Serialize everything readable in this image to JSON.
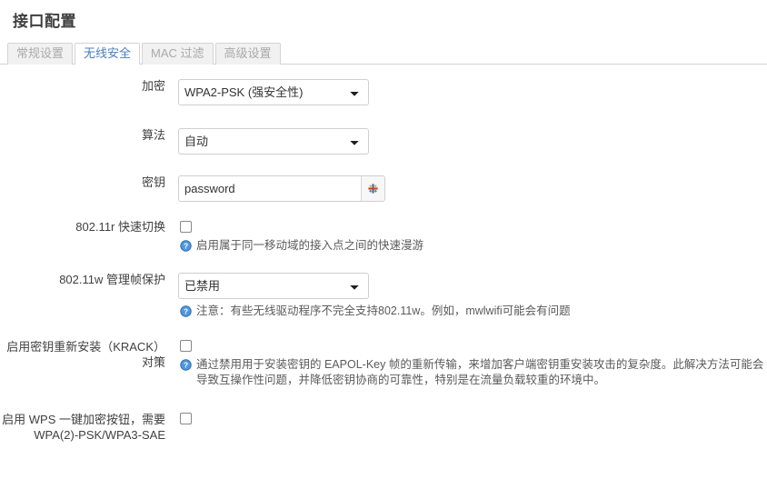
{
  "page": {
    "title": "接口配置"
  },
  "tabs": [
    {
      "label": "常规设置",
      "active": false
    },
    {
      "label": "无线安全",
      "active": true
    },
    {
      "label": "MAC 过滤",
      "active": false
    },
    {
      "label": "高级设置",
      "active": false
    }
  ],
  "form": {
    "encryption": {
      "label": "加密",
      "value": "WPA2-PSK (强安全性)",
      "options": [
        "WPA2-PSK (强安全性)"
      ]
    },
    "cipher": {
      "label": "算法",
      "value": "自动",
      "options": [
        "自动"
      ]
    },
    "key": {
      "label": "密钥",
      "value": "password",
      "placeholder": "",
      "reveal_icon": "asterisk-icon"
    },
    "fast_transition": {
      "label": "802.11r 快速切换",
      "checked": false,
      "hint_icon": "help-circle-icon",
      "hint": "启用属于同一移动域的接入点之间的快速漫游"
    },
    "mfp": {
      "label": "802.11w 管理帧保护",
      "value": "已禁用",
      "options": [
        "已禁用"
      ],
      "hint_icon": "help-circle-icon",
      "hint": "注意：有些无线驱动程序不完全支持802.11w。例如，mwlwifi可能会有问题"
    },
    "krack": {
      "label_line1": "启用密钥重新安装（KRACK）",
      "label_line2": "对策",
      "checked": false,
      "hint_icon": "help-circle-icon",
      "hint": "通过禁用用于安装密钥的 EAPOL-Key 帧的重新传输，来增加客户端密钥重安装攻击的复杂度。此解决方法可能会导致互操作性问题，并降低密钥协商的可靠性，特别是在流量负载较重的环境中。"
    },
    "wps": {
      "label_line1": "启用 WPS 一键加密按钮，需要",
      "label_line2": "WPA(2)-PSK/WPA3-SAE",
      "checked": false
    }
  },
  "colors": {
    "accent": "#4a7ebb",
    "text": "#404040",
    "muted": "#aaaaaa",
    "border": "#d4d4d4",
    "help_icon": "#3c8ede"
  }
}
